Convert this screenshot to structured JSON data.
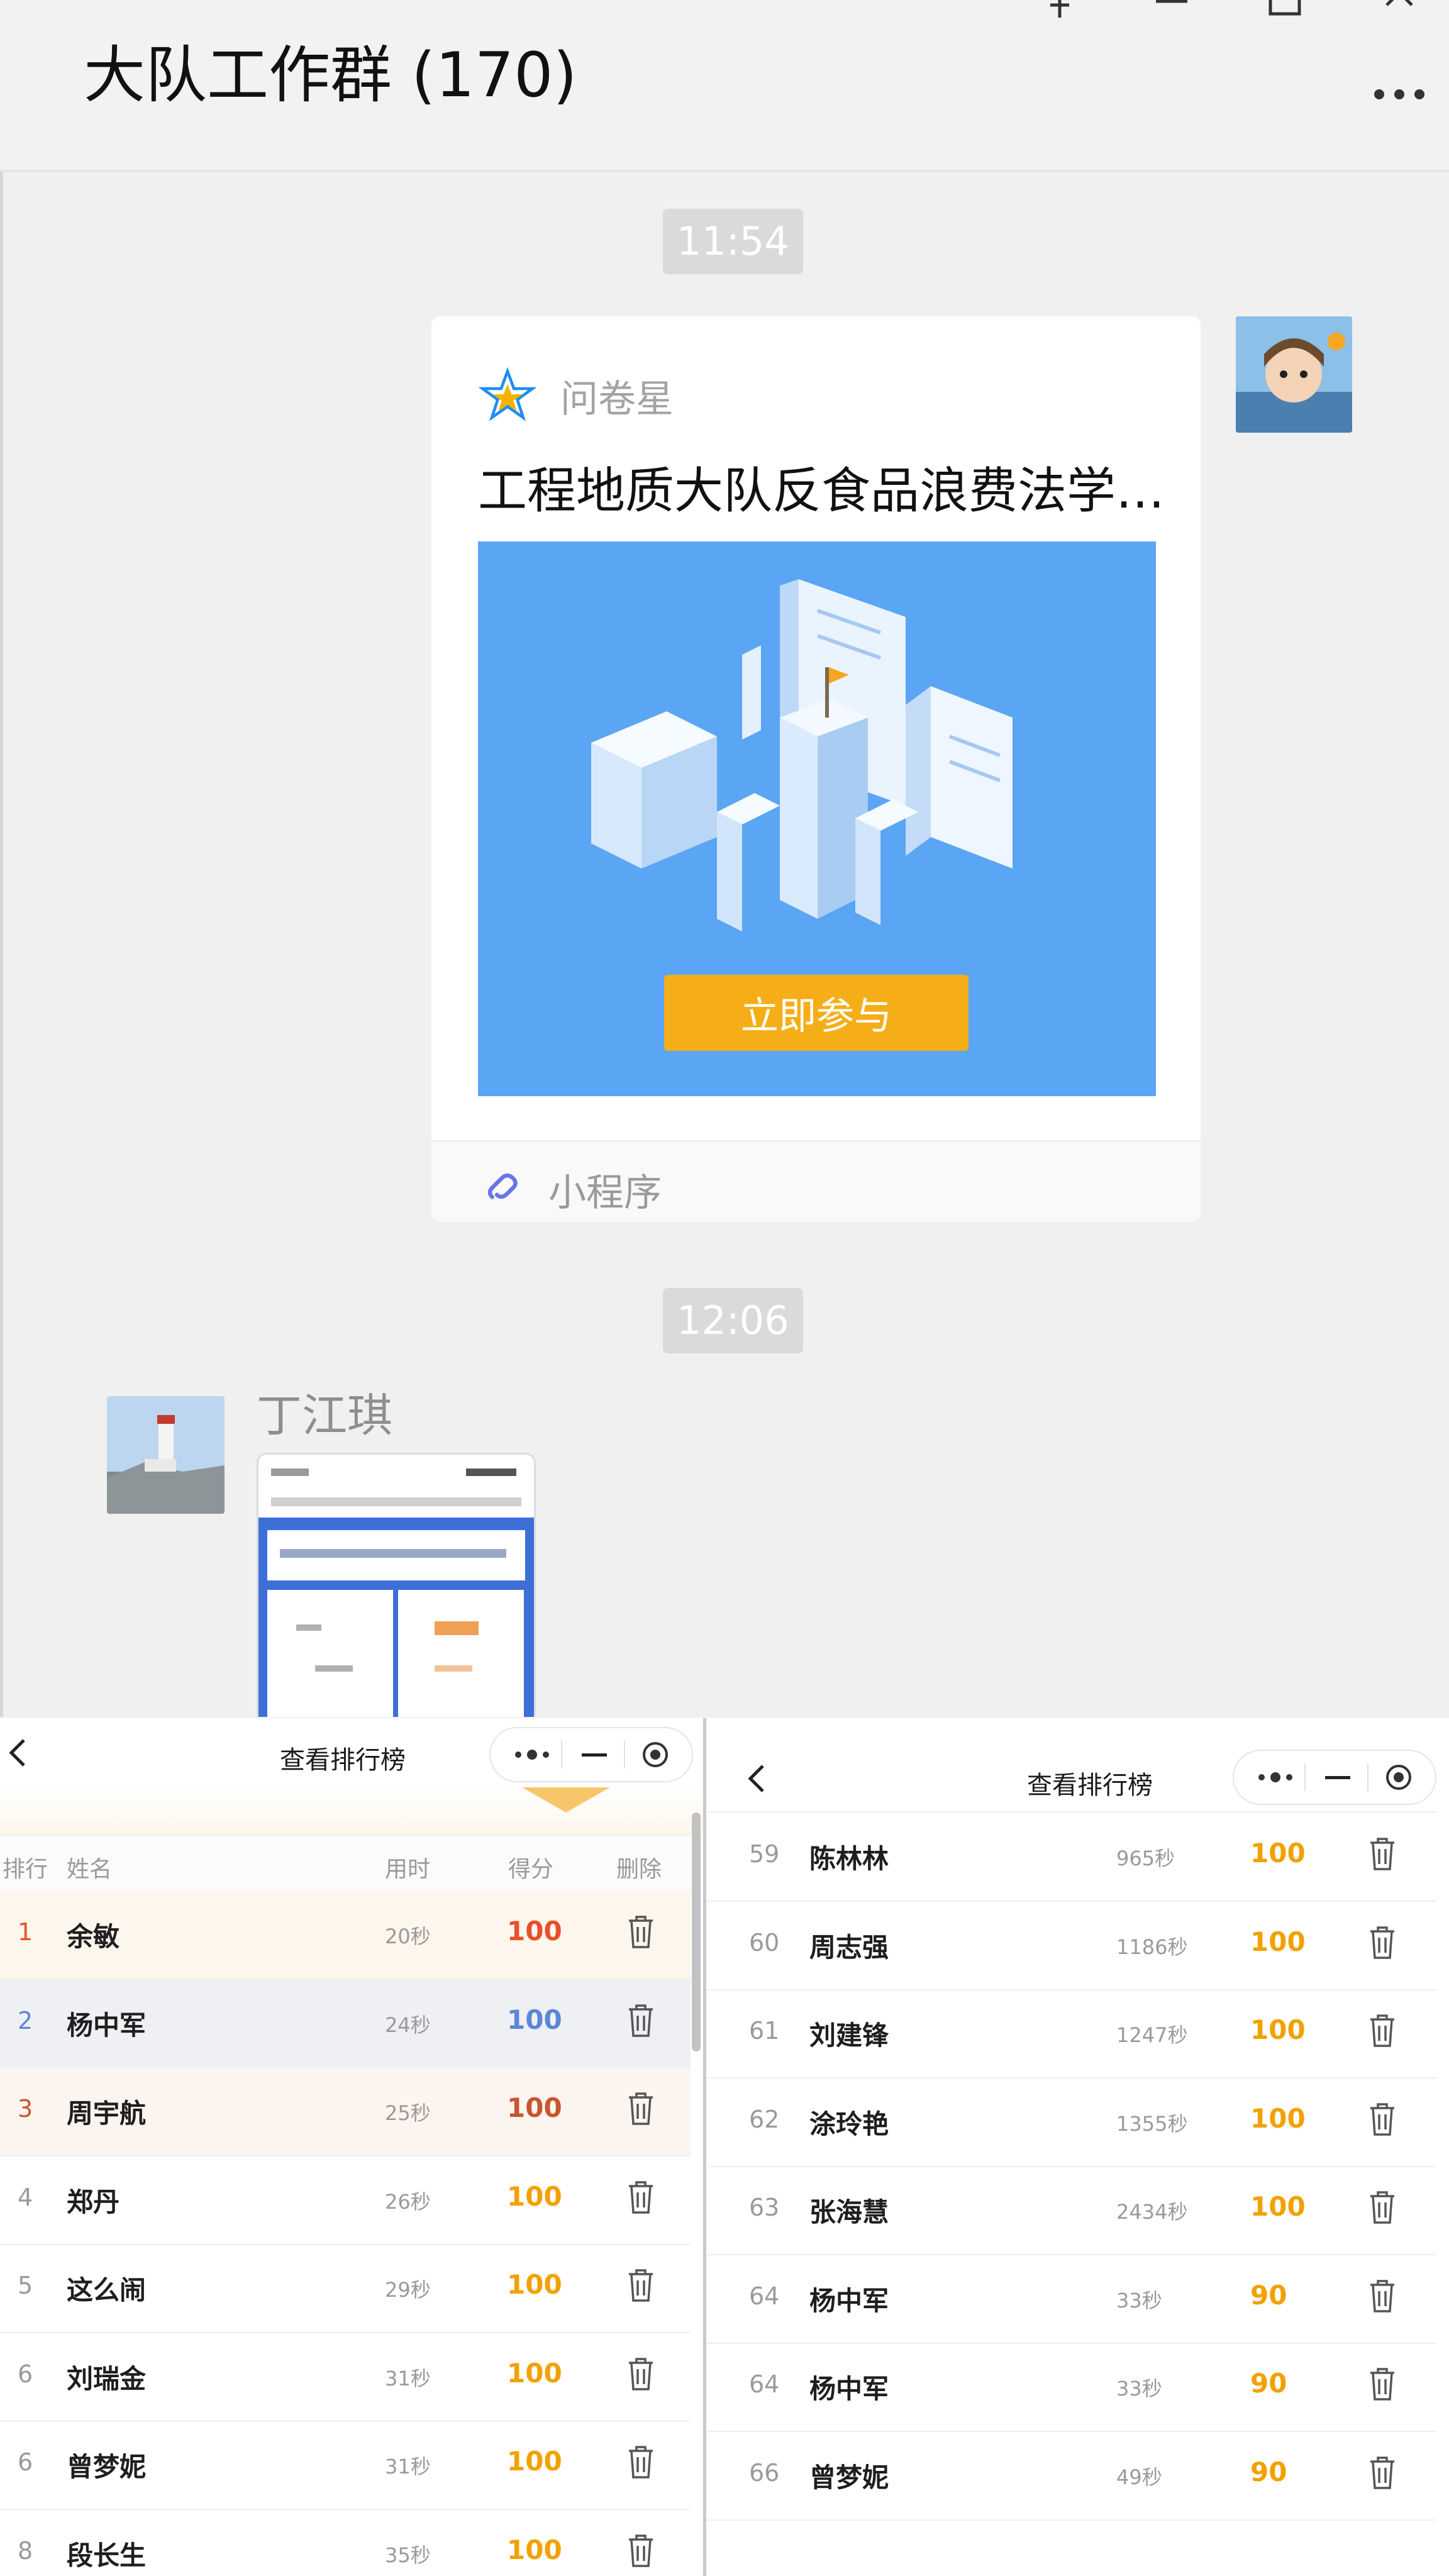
{
  "chat": {
    "title": "大队工作群 (170)",
    "timestamps": [
      "11:54",
      "12:06"
    ],
    "card": {
      "source_name": "问卷星",
      "title": "工程地质大队反食品浪费法学…",
      "join_label": "立即参与",
      "footer_label": "小程序"
    },
    "second_message": {
      "sender_name": "丁江琪"
    }
  },
  "left_panel": {
    "title": "查看排行榜",
    "columns": {
      "rank": "排行",
      "name": "姓名",
      "time": "用时",
      "score": "得分",
      "delete": "删除"
    },
    "rows": [
      {
        "rank": "1",
        "name": "余敏",
        "time": "20秒",
        "score": "100"
      },
      {
        "rank": "2",
        "name": "杨中军",
        "time": "24秒",
        "score": "100"
      },
      {
        "rank": "3",
        "name": "周宇航",
        "time": "25秒",
        "score": "100"
      },
      {
        "rank": "4",
        "name": "郑丹",
        "time": "26秒",
        "score": "100"
      },
      {
        "rank": "5",
        "name": "这么闹",
        "time": "29秒",
        "score": "100"
      },
      {
        "rank": "6",
        "name": "刘瑞金",
        "time": "31秒",
        "score": "100"
      },
      {
        "rank": "6",
        "name": "曾梦妮",
        "time": "31秒",
        "score": "100"
      },
      {
        "rank": "8",
        "name": "段长生",
        "time": "35秒",
        "score": "100"
      }
    ]
  },
  "right_panel": {
    "title": "查看排行榜",
    "rows": [
      {
        "rank": "59",
        "name": "陈林林",
        "time": "965秒",
        "score": "100"
      },
      {
        "rank": "60",
        "name": "周志强",
        "time": "1186秒",
        "score": "100"
      },
      {
        "rank": "61",
        "name": "刘建锋",
        "time": "1247秒",
        "score": "100"
      },
      {
        "rank": "62",
        "name": "涂玲艳",
        "time": "1355秒",
        "score": "100"
      },
      {
        "rank": "63",
        "name": "张海慧",
        "time": "2434秒",
        "score": "100"
      },
      {
        "rank": "64",
        "name": "杨中军",
        "time": "33秒",
        "score": "90"
      },
      {
        "rank": "64",
        "name": "杨中军",
        "time": "33秒",
        "score": "90"
      },
      {
        "rank": "66",
        "name": "曾梦妮",
        "time": "49秒",
        "score": "90"
      }
    ]
  },
  "colors": {
    "score": "#f2a100",
    "rank1": "#e8502b",
    "rank2": "#5b87d6",
    "rank3": "#c5562f",
    "card_cover": "#5aa5f4",
    "join_button": "#f5ae17"
  }
}
